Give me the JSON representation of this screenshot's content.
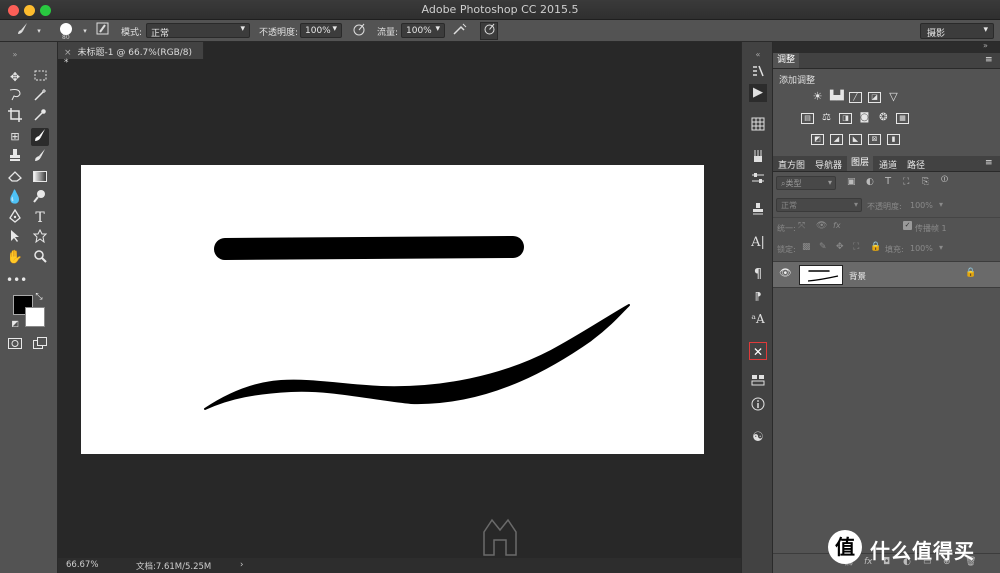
{
  "window": {
    "title": "Adobe Photoshop CC 2015.5"
  },
  "options": {
    "brush_size": "80",
    "mode_label": "模式:",
    "mode_value": "正常",
    "opacity_label": "不透明度:",
    "opacity_value": "100%",
    "flow_label": "流量:",
    "flow_value": "100%",
    "workspace": "摄影"
  },
  "document": {
    "tab_title": "未标题-1 @ 66.7%(RGB/8) *",
    "close_glyph": "×"
  },
  "status": {
    "zoom": "66.67%",
    "doc_size": "文档:7.61M/5.25M",
    "arrow": "›"
  },
  "adjust_panel": {
    "title": "调整",
    "subtitle": "添加调整"
  },
  "layers_panel": {
    "tabs": [
      "直方图",
      "导航器",
      "图层",
      "通道",
      "路径"
    ],
    "active_tab": "图层",
    "filter_label": "类型",
    "blend_mode": "正常",
    "opacity_label": "不透明度:",
    "opacity_value": "100%",
    "unify_label": "统一:",
    "propagate_label": "传播帧 1",
    "lock_label": "锁定:",
    "fill_label": "填充:",
    "fill_value": "100%",
    "layers": [
      {
        "name": "背景",
        "visible": true,
        "locked": true
      }
    ]
  },
  "watermark": {
    "brand": "什么值得买",
    "brand_mark": "值"
  },
  "colors": {
    "foreground": "#000000",
    "background": "#ffffff",
    "ui_dark": "#282828",
    "ui_panel": "#535353",
    "accent_red": "#e03a3a"
  }
}
